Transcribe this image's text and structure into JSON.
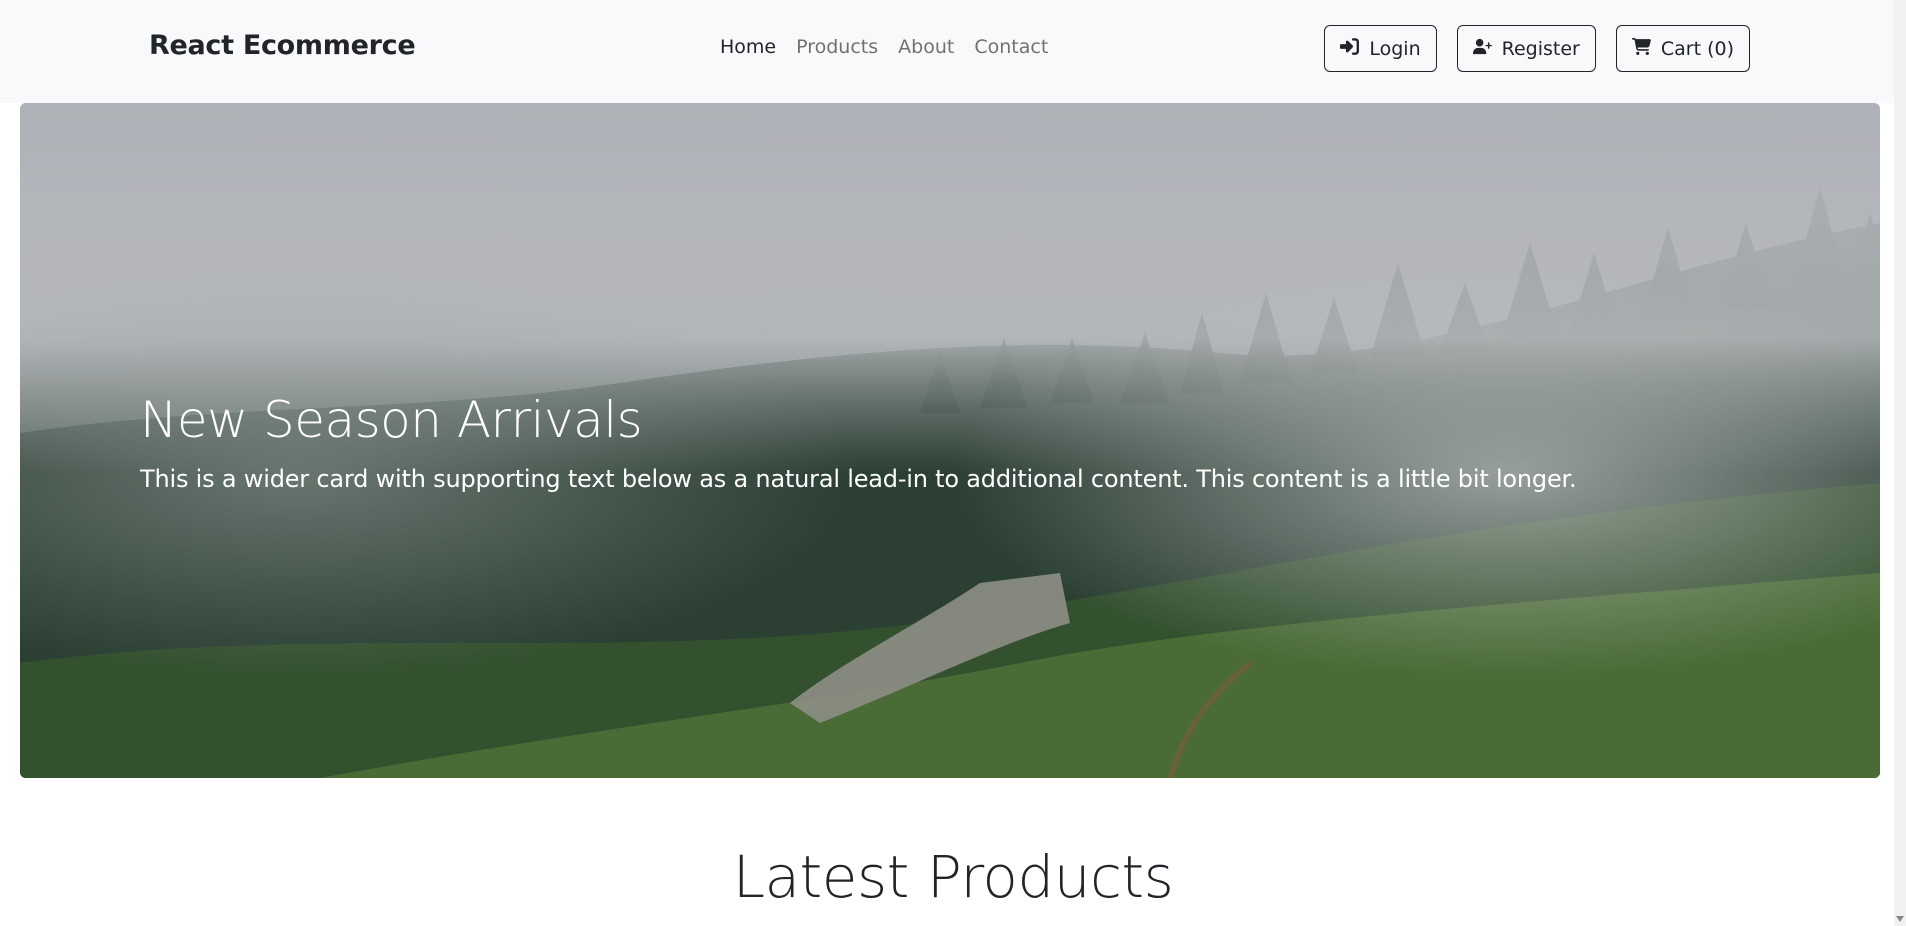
{
  "navbar": {
    "brand": "React Ecommerce",
    "links": [
      {
        "label": "Home",
        "active": true
      },
      {
        "label": "Products",
        "active": false
      },
      {
        "label": "About",
        "active": false
      },
      {
        "label": "Contact",
        "active": false
      }
    ],
    "buttons": {
      "login": {
        "label": "Login",
        "icon": "sign-in-icon"
      },
      "register": {
        "label": "Register",
        "icon": "user-plus-icon"
      },
      "cart": {
        "label": "Cart (0)",
        "icon": "shopping-cart-icon"
      }
    }
  },
  "hero": {
    "title": "New Season Arrivals",
    "subtitle": "This is a wider card with supporting text below as a natural lead-in to additional content. This content is a little bit longer."
  },
  "latest": {
    "title": "Latest Products"
  }
}
